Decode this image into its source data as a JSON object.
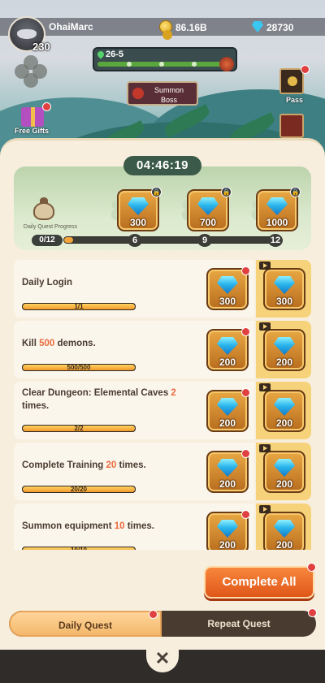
{
  "player": {
    "name": "OhaiMarc",
    "level": "230"
  },
  "currency": {
    "gold": "86.16B",
    "gems": "28730"
  },
  "stage": {
    "label": "26-5"
  },
  "summon_boss": {
    "line1": "Summon",
    "line2": "Boss"
  },
  "sidebar": {
    "free_gifts": "Free Gifts",
    "pass": "Pass"
  },
  "timer": "04:46:19",
  "daily_progress": {
    "label": "Daily Quest Progress",
    "count": "0/12",
    "fraction": 0,
    "milestones": [
      {
        "value": "6",
        "reward": "300",
        "locked": true
      },
      {
        "value": "9",
        "reward": "700",
        "locked": true
      },
      {
        "value": "12",
        "reward": "1000",
        "locked": true
      }
    ]
  },
  "quests": [
    {
      "pre": "Daily Login",
      "hl": "",
      "post": "",
      "progress": "1/1",
      "fraction": 1,
      "reward": "300",
      "ad_reward": "300"
    },
    {
      "pre": "Kill ",
      "hl": "500",
      "post": " demons.",
      "progress": "500/500",
      "fraction": 1,
      "reward": "200",
      "ad_reward": "200"
    },
    {
      "pre": "Clear Dungeon: Elemental Caves ",
      "hl": "2",
      "post": " times.",
      "progress": "2/2",
      "fraction": 1,
      "reward": "200",
      "ad_reward": "200"
    },
    {
      "pre": "Complete Training ",
      "hl": "20",
      "post": " times.",
      "progress": "20/20",
      "fraction": 1,
      "reward": "200",
      "ad_reward": "200"
    },
    {
      "pre": "Summon equipment ",
      "hl": "10",
      "post": " times.",
      "progress": "10/10",
      "fraction": 1,
      "reward": "200",
      "ad_reward": "200"
    }
  ],
  "complete_all": "Complete All",
  "tabs": {
    "daily": "Daily Quest",
    "repeat": "Repeat Quest"
  },
  "close_glyph": "✕",
  "colors": {
    "accent": "#e0561a",
    "highlight": "#ea6a3e",
    "gem": "#2bb6ec",
    "panel": "#f7eedd"
  }
}
